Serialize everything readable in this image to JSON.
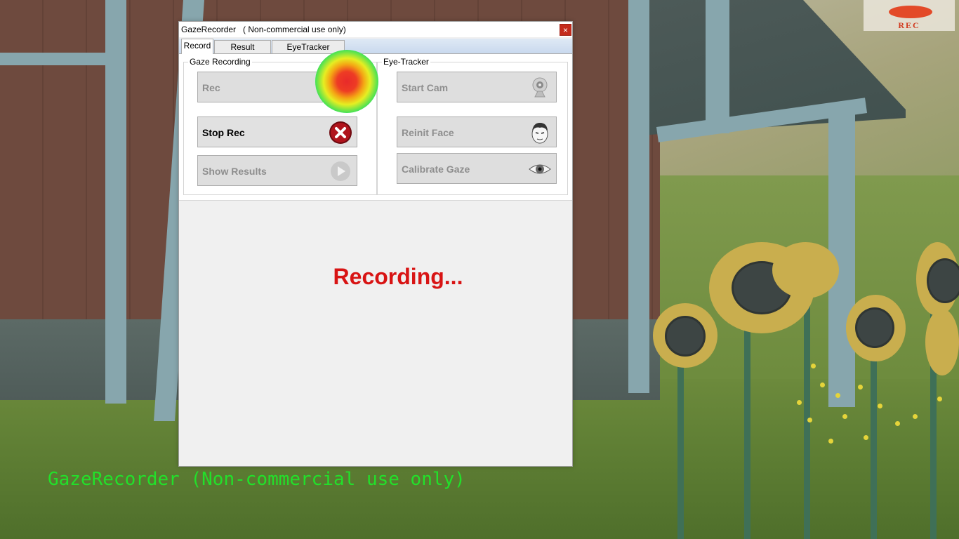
{
  "window": {
    "title": "GazeRecorder   ( Non-commercial use only)",
    "close_label": "×"
  },
  "tabs": [
    {
      "label": "Record",
      "active": true
    },
    {
      "label": "Result Settings",
      "active": false
    },
    {
      "label": "EyeTracker Settings",
      "active": false
    }
  ],
  "gaze_recording": {
    "group_label": "Gaze Recording",
    "rec_label": "Rec",
    "stop_rec_label": "Stop Rec",
    "show_results_label": "Show Results"
  },
  "eye_tracker": {
    "group_label": "Eye-Tracker",
    "start_cam_label": "Start Cam",
    "reinit_face_label": "Reinit Face",
    "calibrate_gaze_label": "Calibrate Gaze"
  },
  "status_text": "Recording...",
  "rec_badge_text": "REC",
  "watermark_text": "GazeRecorder (Non-commercial use only)",
  "colors": {
    "status": "#d81414",
    "watermark": "#22e02a",
    "rec_badge": "#e34a28",
    "stop_icon": "#b0141c"
  }
}
